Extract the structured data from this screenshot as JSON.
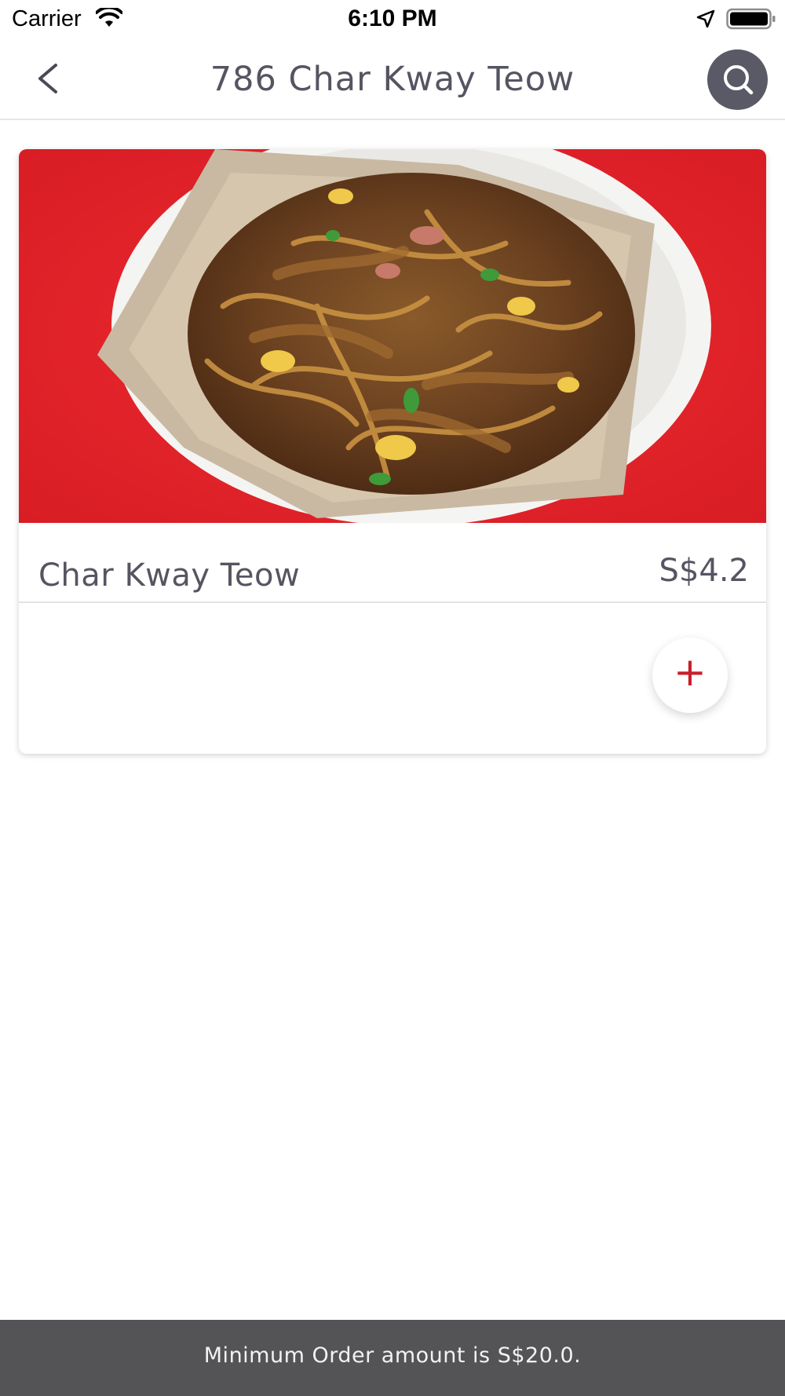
{
  "status_bar": {
    "carrier": "Carrier",
    "time": "6:10 PM",
    "icons": [
      "wifi-icon",
      "location-arrow-icon",
      "battery-icon"
    ]
  },
  "nav": {
    "title": "786 Char Kway Teow",
    "back_icon": "chevron-left-icon",
    "search_icon": "search-icon"
  },
  "menu_items": [
    {
      "name": "Char Kway Teow",
      "price": "S$4.2",
      "add_icon": "plus-icon",
      "add_symbol": "+"
    }
  ],
  "footer": {
    "message": "Minimum Order amount is S$20.0."
  },
  "colors": {
    "accent": "#c8202a",
    "nav_text": "#555562",
    "search_bg": "#5a5a66",
    "footer_bg": "#545456",
    "image_bg": "#e3222a"
  }
}
